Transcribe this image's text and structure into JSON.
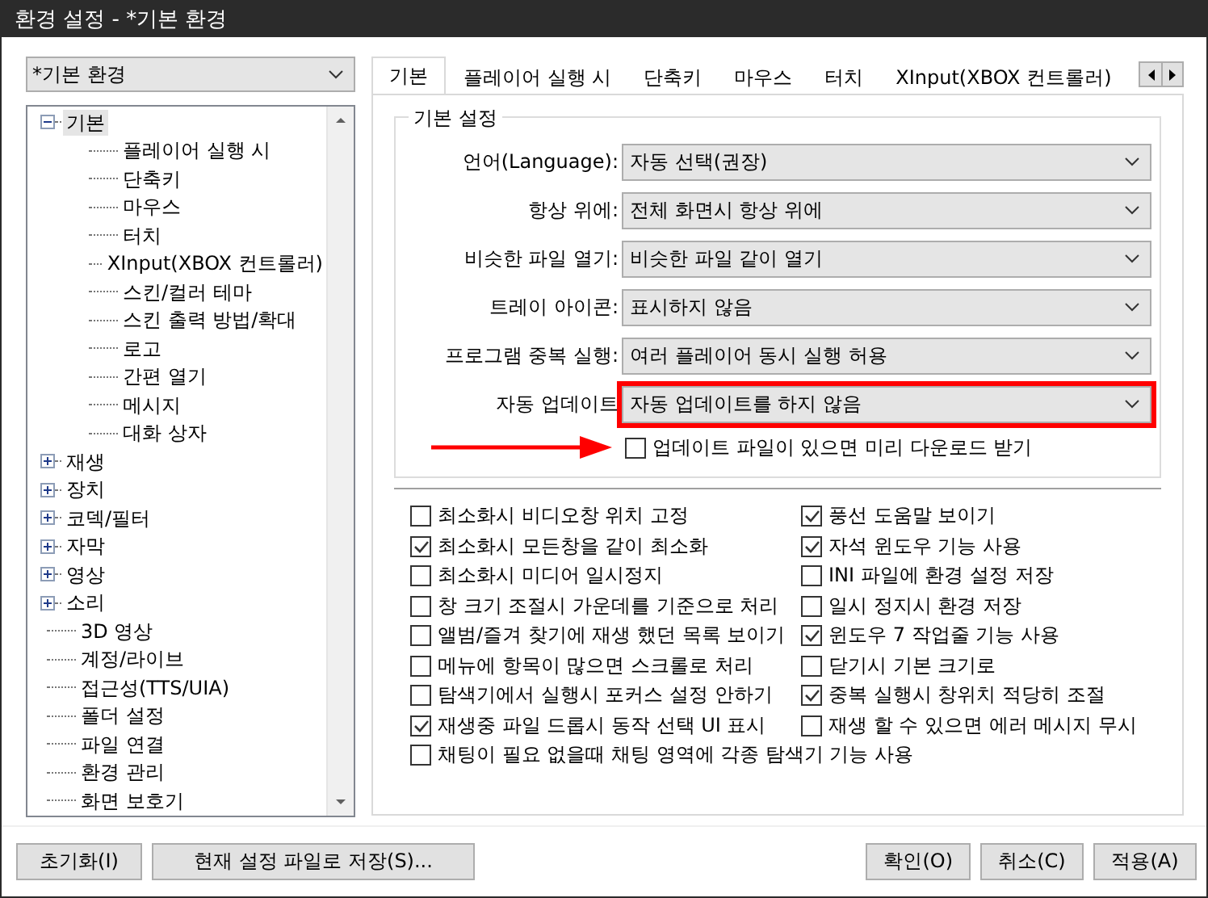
{
  "window": {
    "title": "환경 설정 - *기본 환경"
  },
  "profile": {
    "value": "*기본 환경"
  },
  "tree": [
    {
      "label": "기본",
      "kind": "group",
      "expanded": true,
      "selected": true,
      "children": [
        {
          "label": "플레이어 실행 시"
        },
        {
          "label": "단축키"
        },
        {
          "label": "마우스"
        },
        {
          "label": "터치"
        },
        {
          "label": "XInput(XBOX 컨트롤러)"
        },
        {
          "label": "스킨/컬러 테마"
        },
        {
          "label": "스킨 출력 방법/확대"
        },
        {
          "label": "로고"
        },
        {
          "label": "간편 열기"
        },
        {
          "label": "메시지"
        },
        {
          "label": "대화 상자"
        }
      ]
    },
    {
      "label": "재생",
      "kind": "group",
      "expanded": false,
      "selected": false
    },
    {
      "label": "장치",
      "kind": "group",
      "expanded": false,
      "selected": false
    },
    {
      "label": "코덱/필터",
      "kind": "group",
      "expanded": false,
      "selected": false
    },
    {
      "label": "자막",
      "kind": "group",
      "expanded": false,
      "selected": false
    },
    {
      "label": "영상",
      "kind": "group",
      "expanded": false,
      "selected": false
    },
    {
      "label": "소리",
      "kind": "group",
      "expanded": false,
      "selected": false
    },
    {
      "label": "3D 영상",
      "selected": false
    },
    {
      "label": "계정/라이브",
      "selected": false
    },
    {
      "label": "접근성(TTS/UIA)",
      "selected": false
    },
    {
      "label": "폴더 설정",
      "selected": false
    },
    {
      "label": "파일 연결",
      "selected": false
    },
    {
      "label": "환경 관리",
      "selected": false
    },
    {
      "label": "화면 보호기",
      "selected": false
    }
  ],
  "tabs": [
    {
      "label": "기본",
      "selected": true
    },
    {
      "label": "플레이어 실행 시",
      "selected": false
    },
    {
      "label": "단축키",
      "selected": false
    },
    {
      "label": "마우스",
      "selected": false
    },
    {
      "label": "터치",
      "selected": false
    },
    {
      "label": "XInput(XBOX 컨트롤러)",
      "selected": false
    }
  ],
  "group": {
    "title": "기본 설정",
    "settings": [
      {
        "label": "언어(Language):",
        "value": "자동 선택(권장)",
        "highlighted": false
      },
      {
        "label": "항상 위에:",
        "value": "전체 화면시 항상 위에",
        "highlighted": false
      },
      {
        "label": "비슷한 파일 열기:",
        "value": "비슷한 파일 같이 열기",
        "highlighted": false
      },
      {
        "label": "트레이 아이콘:",
        "value": "표시하지 않음",
        "highlighted": false
      },
      {
        "label": "프로그램 중복 실행:",
        "value": "여러 플레이어 동시 실행 허용",
        "highlighted": false
      },
      {
        "label": "자동 업데이트",
        "value": "자동 업데이트를 하지 않음",
        "highlighted": true
      }
    ],
    "update_option": {
      "label": "업데이트 파일이 있으면 미리 다운로드 받기",
      "checked": false,
      "pointed": true
    }
  },
  "options_left": [
    {
      "label": "최소화시 비디오창 위치 고정",
      "checked": false
    },
    {
      "label": "최소화시 모든창을 같이 최소화",
      "checked": true
    },
    {
      "label": "최소화시 미디어 일시정지",
      "checked": false
    },
    {
      "label": "창 크기 조절시 가운데를 기준으로 처리",
      "checked": false
    },
    {
      "label": "앨범/즐겨 찾기에 재생 했던 목록 보이기",
      "checked": false
    },
    {
      "label": "메뉴에 항목이 많으면 스크롤로 처리",
      "checked": false
    },
    {
      "label": "탐색기에서 실행시 포커스 설정 안하기",
      "checked": false
    },
    {
      "label": "재생중 파일 드롭시 동작 선택 UI 표시",
      "checked": true
    },
    {
      "label": "채팅이 필요 없을때 채팅 영역에 각종 탐색기 기능 사용",
      "checked": false
    }
  ],
  "options_right": [
    {
      "label": "풍선 도움말 보이기",
      "checked": true
    },
    {
      "label": "자석 윈도우 기능 사용",
      "checked": true
    },
    {
      "label": "INI 파일에 환경 설정 저장",
      "checked": false
    },
    {
      "label": "일시 정지시 환경 저장",
      "checked": false
    },
    {
      "label": "윈도우 7 작업줄 기능 사용",
      "checked": true
    },
    {
      "label": "닫기시 기본 크기로",
      "checked": false
    },
    {
      "label": "중복 실행시 창위치 적당히 조절",
      "checked": true
    },
    {
      "label": "재생 할 수 있으면 에러 메시지 무시",
      "checked": false
    }
  ],
  "buttons_left": [
    "초기화(I)",
    "현재 설정 파일로 저장(S)..."
  ],
  "buttons_right": [
    "확인(O)",
    "취소(C)",
    "적용(A)"
  ]
}
